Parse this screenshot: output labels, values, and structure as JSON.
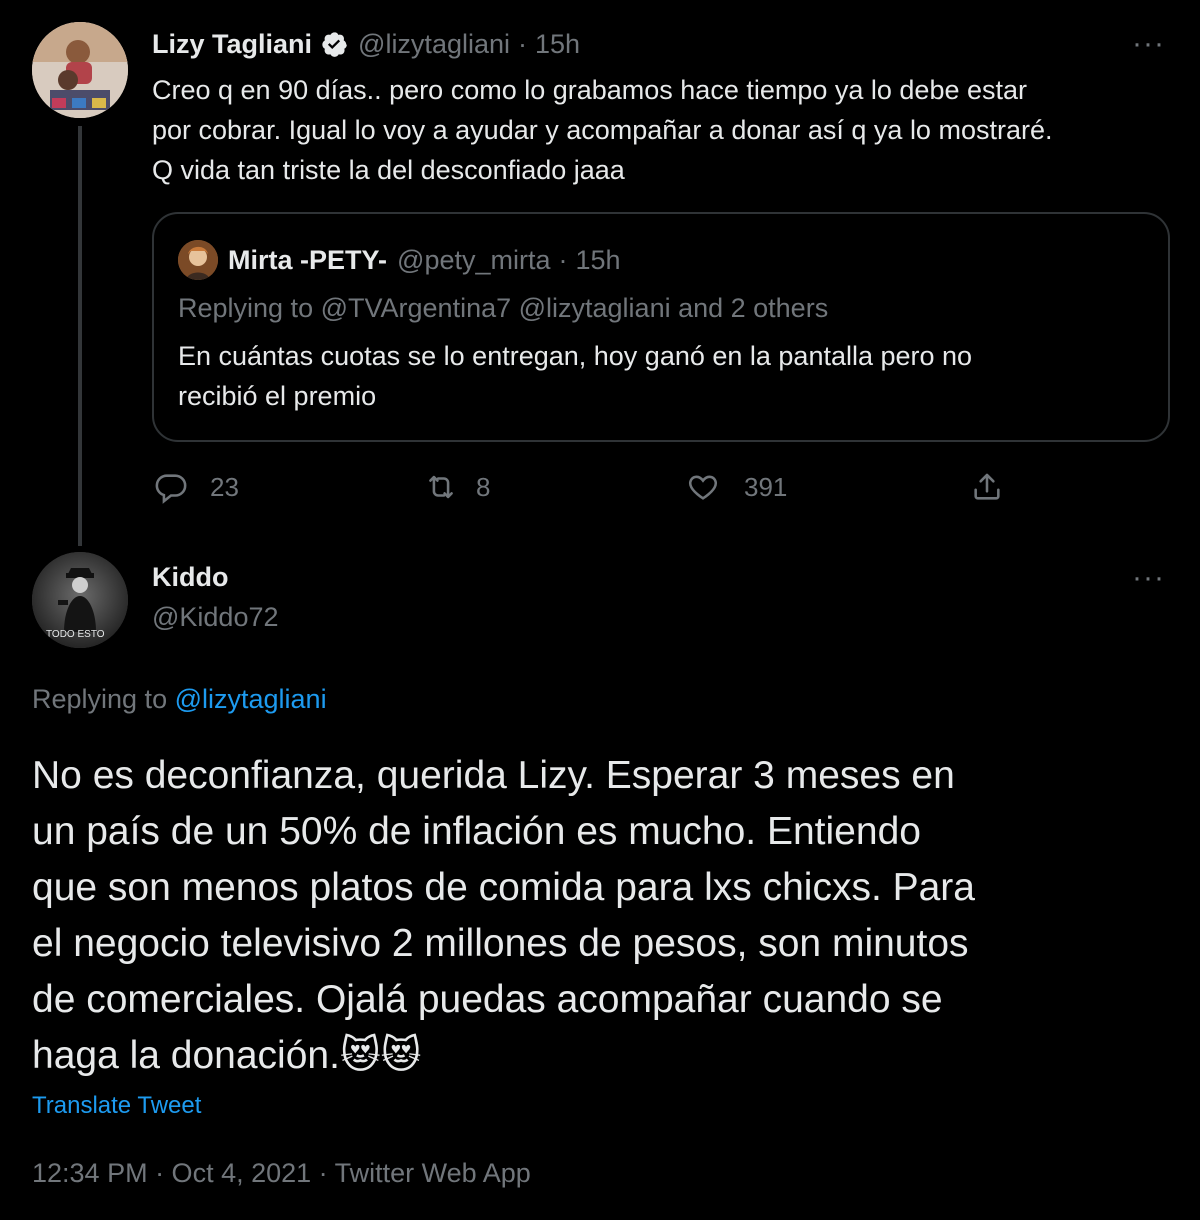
{
  "tweet1": {
    "name": "Lizy Tagliani",
    "handle": "@lizytagliani",
    "time": "15h",
    "text_lines": [
      "Creo q en 90 días..   pero como lo grabamos hace tiempo ya lo debe estar",
      "por cobrar. Igual lo voy a ayudar y acompañar a donar así q ya lo mostraré.",
      "Q vida tan triste la del desconfiado jaaa"
    ],
    "quote": {
      "name": "Mirta -PETY-",
      "handle": "@pety_mirta",
      "time": "15h",
      "replying_prefix": "Replying to",
      "replying_to": "@TVArgentina7 @lizytagliani and 2 others",
      "text_lines": [
        "En cuántas cuotas se lo entregan, hoy ganó en la pantalla pero no",
        "recibió el premio"
      ]
    },
    "actions": {
      "replies": "23",
      "retweets": "8",
      "likes": "391"
    }
  },
  "tweet2": {
    "name": "Kiddo",
    "handle": "@Kiddo72",
    "avatar_caption": "TODO ESTO",
    "replying_prefix": "Replying to",
    "replying_to": "@lizytagliani",
    "text_lines": [
      "No es deconfianza, querida Lizy. Esperar 3 meses en",
      "un país de un 50% de inflación es mucho. Entiendo",
      "que son menos platos de comida para lxs chicxs. Para",
      "el negocio televisivo 2 millones de pesos, son minutos",
      "de comerciales. Ojalá puedas acompañar cuando se",
      "haga la donación."
    ],
    "emoji": "😻😻",
    "translate": "Translate Tweet",
    "meta": "12:34 PM · Oct 4, 2021 · Twitter Web App"
  },
  "colors": {
    "background": "#000000",
    "text": "#e7e9ea",
    "muted": "#71767b",
    "link": "#1d9bf0",
    "border": "#2f3336"
  }
}
